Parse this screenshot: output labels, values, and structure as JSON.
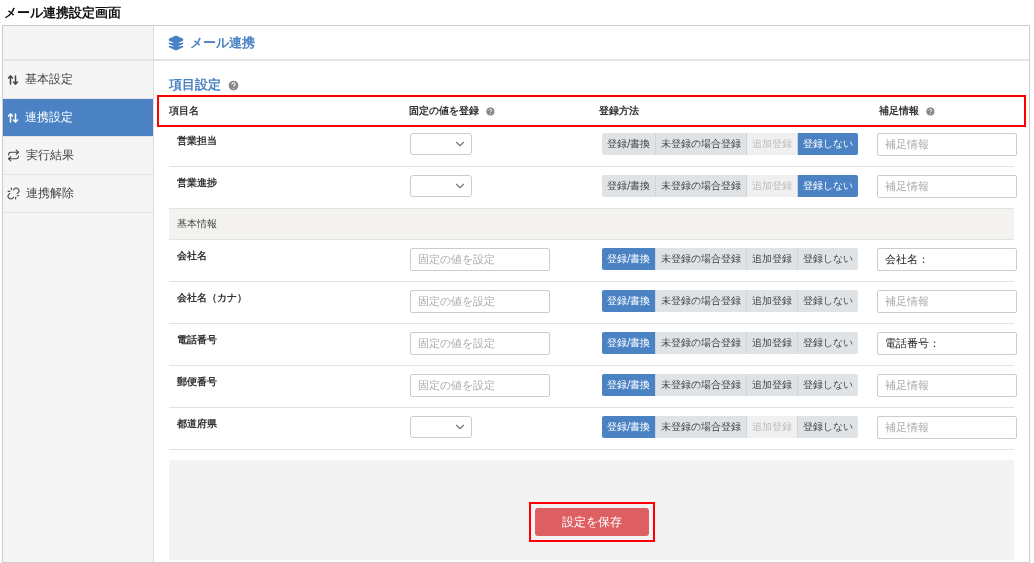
{
  "page_title": "メール連携設定画面",
  "sidebar": {
    "items": [
      {
        "label": "基本設定",
        "selected": false
      },
      {
        "label": "連携設定",
        "selected": true
      },
      {
        "label": "実行結果",
        "selected": false
      },
      {
        "label": "連携解除",
        "selected": false
      }
    ]
  },
  "header": {
    "title": "メール連携"
  },
  "section_title": "項目設定",
  "table": {
    "highlighted": true,
    "columns": [
      {
        "label": "項目名",
        "help": false
      },
      {
        "label": "固定の値を登録",
        "help": true
      },
      {
        "label": "登録方法",
        "help": false
      },
      {
        "label": "補足情報",
        "help": true
      }
    ],
    "rows": [
      {
        "kind": "row",
        "name": "営業担当",
        "fixed": {
          "kind": "select"
        },
        "methods": [
          {
            "label": "登録/書換",
            "selected": false,
            "disabled": false
          },
          {
            "label": "未登録の場合登録",
            "selected": false,
            "disabled": false
          },
          {
            "label": "追加登録",
            "selected": false,
            "disabled": true
          },
          {
            "label": "登録しない",
            "selected": true,
            "disabled": false
          }
        ],
        "info": {
          "placeholder": "補足情報"
        }
      },
      {
        "kind": "row",
        "name": "営業進捗",
        "fixed": {
          "kind": "select"
        },
        "methods": [
          {
            "label": "登録/書換",
            "selected": false,
            "disabled": false
          },
          {
            "label": "未登録の場合登録",
            "selected": false,
            "disabled": false
          },
          {
            "label": "追加登録",
            "selected": false,
            "disabled": true
          },
          {
            "label": "登録しない",
            "selected": true,
            "disabled": false
          }
        ],
        "info": {
          "placeholder": "補足情報"
        }
      },
      {
        "kind": "section",
        "name": "基本情報"
      },
      {
        "kind": "row",
        "name": "会社名",
        "fixed": {
          "kind": "input",
          "placeholder": "固定の値を設定"
        },
        "methods": [
          {
            "label": "登録/書換",
            "selected": true,
            "disabled": false
          },
          {
            "label": "未登録の場合登録",
            "selected": false,
            "disabled": false
          },
          {
            "label": "追加登録",
            "selected": false,
            "disabled": false
          },
          {
            "label": "登録しない",
            "selected": false,
            "disabled": false
          }
        ],
        "info": {
          "value": "会社名："
        }
      },
      {
        "kind": "row",
        "name": "会社名（カナ）",
        "fixed": {
          "kind": "input",
          "placeholder": "固定の値を設定"
        },
        "methods": [
          {
            "label": "登録/書換",
            "selected": true,
            "disabled": false
          },
          {
            "label": "未登録の場合登録",
            "selected": false,
            "disabled": false
          },
          {
            "label": "追加登録",
            "selected": false,
            "disabled": false
          },
          {
            "label": "登録しない",
            "selected": false,
            "disabled": false
          }
        ],
        "info": {
          "placeholder": "補足情報"
        }
      },
      {
        "kind": "row",
        "name": "電話番号",
        "fixed": {
          "kind": "input",
          "placeholder": "固定の値を設定"
        },
        "methods": [
          {
            "label": "登録/書換",
            "selected": true,
            "disabled": false
          },
          {
            "label": "未登録の場合登録",
            "selected": false,
            "disabled": false
          },
          {
            "label": "追加登録",
            "selected": false,
            "disabled": false
          },
          {
            "label": "登録しない",
            "selected": false,
            "disabled": false
          }
        ],
        "info": {
          "value": "電話番号："
        }
      },
      {
        "kind": "row",
        "name": "郵便番号",
        "fixed": {
          "kind": "input",
          "placeholder": "固定の値を設定"
        },
        "methods": [
          {
            "label": "登録/書換",
            "selected": true,
            "disabled": false
          },
          {
            "label": "未登録の場合登録",
            "selected": false,
            "disabled": false
          },
          {
            "label": "追加登録",
            "selected": false,
            "disabled": false
          },
          {
            "label": "登録しない",
            "selected": false,
            "disabled": false
          }
        ],
        "info": {
          "placeholder": "補足情報"
        }
      },
      {
        "kind": "row",
        "name": "都道府県",
        "fixed": {
          "kind": "select"
        },
        "methods": [
          {
            "label": "登録/書換",
            "selected": true,
            "disabled": false
          },
          {
            "label": "未登録の場合登録",
            "selected": false,
            "disabled": false
          },
          {
            "label": "追加登録",
            "selected": false,
            "disabled": true
          },
          {
            "label": "登録しない",
            "selected": false,
            "disabled": false
          }
        ],
        "info": {
          "placeholder": "補足情報"
        }
      }
    ]
  },
  "save_button": {
    "label": "設定を保存",
    "highlighted": true
  }
}
